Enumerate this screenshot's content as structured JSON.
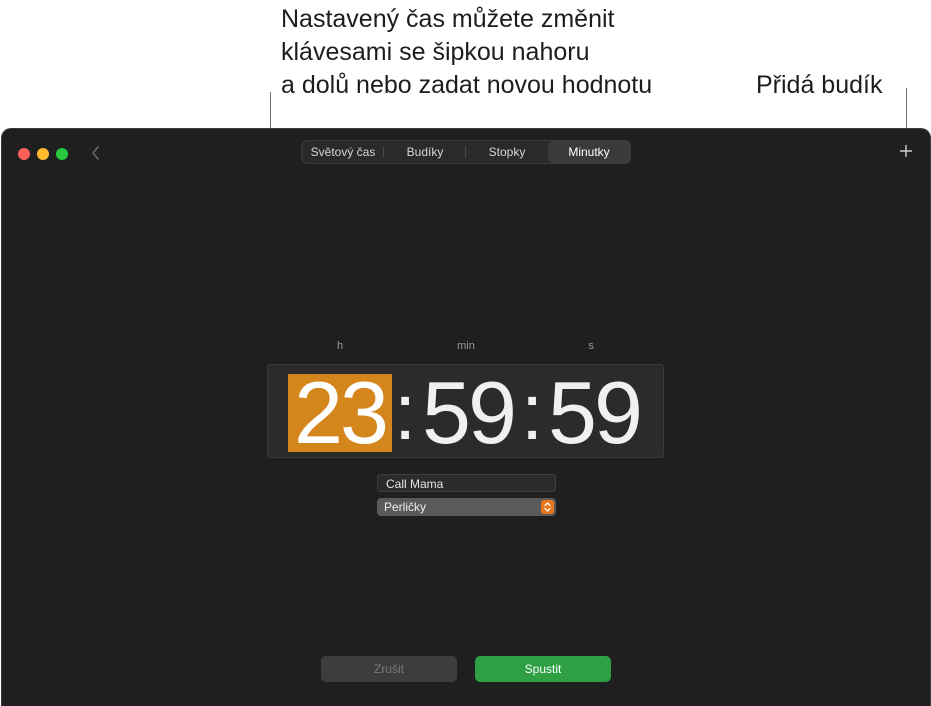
{
  "annotations": {
    "left_callout_lines": [
      "Nastavený čas můžete změnit",
      "klávesami se šipkou nahoru",
      "a dolů nebo zadat novou hodnotu"
    ],
    "right_callout": "Přidá budík"
  },
  "window": {
    "tabs": [
      {
        "label": "Světový čas",
        "active": false
      },
      {
        "label": "Budíky",
        "active": false
      },
      {
        "label": "Stopky",
        "active": false
      },
      {
        "label": "Minutky",
        "active": true
      }
    ],
    "back_icon": "chevron-left-icon",
    "add_icon": "plus-icon"
  },
  "timer": {
    "units": {
      "hours": "h",
      "minutes": "min",
      "seconds": "s"
    },
    "hours": "23",
    "minutes": "59",
    "seconds": "59",
    "separator": ":"
  },
  "fields": {
    "label_value": "Call Mama",
    "sound_value": "Perličky"
  },
  "buttons": {
    "cancel_label": "Zrušit",
    "start_label": "Spustit"
  },
  "colors": {
    "accent_orange": "#d4861c",
    "start_green": "#2ea043",
    "window_bg": "#1f1f1f"
  }
}
